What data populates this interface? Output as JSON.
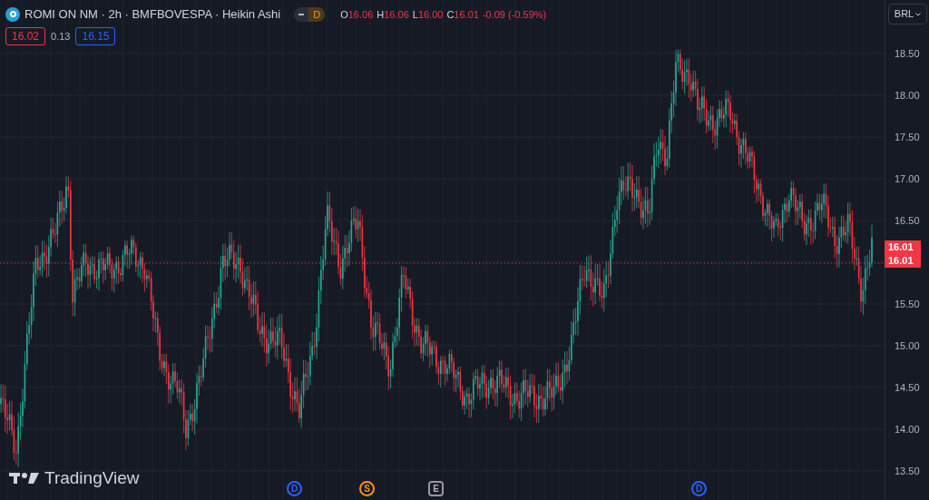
{
  "legend": {
    "title": "ROMI ON NM · 2h · BMFBOVESPA · Heikin Ashi",
    "badge": "D",
    "ohlc": [
      {
        "label": "O",
        "value": "16.06"
      },
      {
        "label": "H",
        "value": "16.06"
      },
      {
        "label": "L",
        "value": "16.00"
      },
      {
        "label": "C",
        "value": "16.01"
      }
    ],
    "change": "-0.09 (-0.59%)",
    "bid": "16.02",
    "spread": "0.13",
    "ask": "16.15"
  },
  "currency": "BRL",
  "price_scale": [
    "18.50",
    "18.00",
    "17.50",
    "17.00",
    "16.50",
    "15.50",
    "15.00",
    "14.50",
    "14.00",
    "13.50"
  ],
  "last_price_labels": [
    "16.01",
    "16.01"
  ],
  "events": [
    {
      "letter": "D",
      "kind": "dividend"
    },
    {
      "letter": "S",
      "kind": "split"
    },
    {
      "letter": "E",
      "kind": "earnings"
    },
    {
      "letter": "D",
      "kind": "dividend"
    }
  ],
  "watermark_text": "TradingView"
}
